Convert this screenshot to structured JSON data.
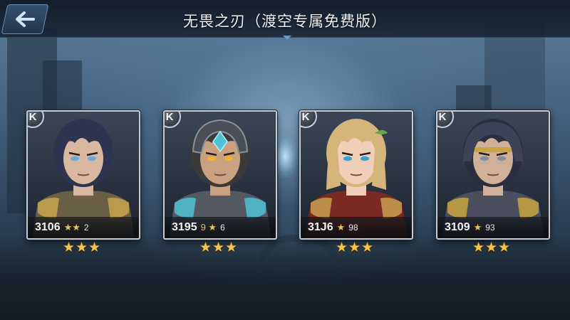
{
  "header": {
    "title": "无畏之刃（渡空专属免费版）",
    "back_icon": "back-arrow-icon"
  },
  "heroes": [
    {
      "grade": "K",
      "power": "3106",
      "star_mark": "★★",
      "extra": "2",
      "stars": 3,
      "stars_text": "★★★",
      "palette": {
        "hair": "#2d3450",
        "armor": "#6a6048",
        "trim": "#c9a550",
        "skin": "#d8b8a0",
        "eye": "#6aa8d8"
      }
    },
    {
      "grade": "K",
      "power": "3195",
      "star_mark": "9 ★",
      "extra": "6",
      "stars": 3,
      "stars_text": "★★★",
      "palette": {
        "hair": "#3a3a3a",
        "armor": "#555a60",
        "trim": "#4fc3d6",
        "skin": "#c9a080",
        "eye": "#f0b030"
      }
    },
    {
      "grade": "K",
      "power": "31J6",
      "star_mark": "★",
      "extra": "98",
      "stars": 3,
      "stars_text": "★★★",
      "palette": {
        "hair": "#d6b57a",
        "armor": "#7a2a22",
        "trim": "#c8a050",
        "skin": "#f0cfb8",
        "eye": "#3aa0d8"
      }
    },
    {
      "grade": "K",
      "power": "3109",
      "star_mark": "★",
      "extra": "93",
      "stars": 3,
      "stars_text": "★★★",
      "palette": {
        "hair": "#2a2e3e",
        "armor": "#4a4e5e",
        "trim": "#c9a440",
        "skin": "#d0b098",
        "eye": "#7a8fa0"
      }
    }
  ]
}
